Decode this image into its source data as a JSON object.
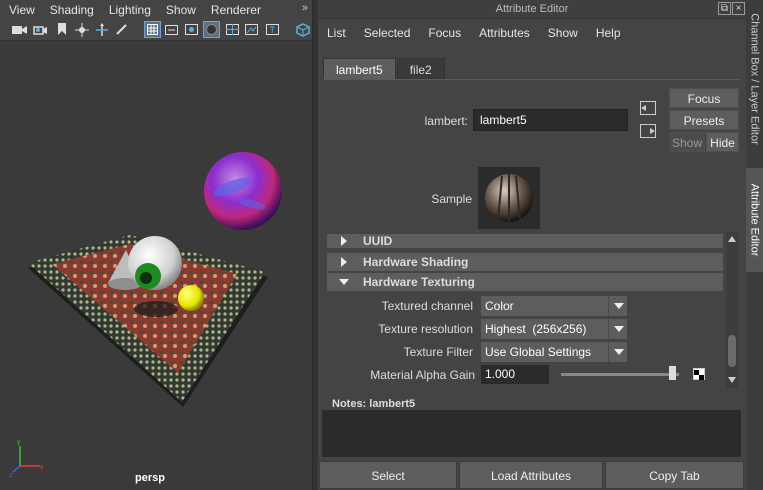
{
  "viewport": {
    "menus": [
      "View",
      "Shading",
      "Lighting",
      "Show",
      "Renderer"
    ],
    "more_glyph": "»",
    "camera_label": "persp",
    "toolbar_icons": [
      "camera-icon",
      "camera-attributes-icon",
      "bookmark-icon",
      "move-pivot-icon",
      "brush-icon",
      "grid-icon",
      "film-gate-icon",
      "resolution-gate-icon",
      "gate-mask-icon",
      "field-chart-icon",
      "safe-action-icon",
      "safe-title-icon",
      "isolate-icon"
    ],
    "axis_colors": {
      "x": "#e04040",
      "y": "#40c040",
      "z": "#4060e0"
    }
  },
  "attribute_editor": {
    "title": "Attribute Editor",
    "menus": [
      "List",
      "Selected",
      "Focus",
      "Attributes",
      "Show",
      "Help"
    ],
    "tabs": [
      "lambert5",
      "file2"
    ],
    "active_tab": "lambert5",
    "node_type_label": "lambert:",
    "node_name": "lambert5",
    "buttons": {
      "focus": "Focus",
      "presets": "Presets",
      "show": "Show",
      "hide": "Hide"
    },
    "sample_label": "Sample",
    "sections": [
      {
        "label": "UUID",
        "expanded": false
      },
      {
        "label": "Hardware Shading",
        "expanded": false
      },
      {
        "label": "Hardware Texturing",
        "expanded": true
      }
    ],
    "attributes": {
      "textured_channel": {
        "label": "Textured channel",
        "value": "Color"
      },
      "texture_resolution": {
        "label": "Texture resolution",
        "value": "Highest  (256x256)"
      },
      "texture_filter": {
        "label": "Texture Filter",
        "value": "Use Global Settings"
      },
      "material_alpha_gain": {
        "label": "Material Alpha Gain",
        "value": "1.000",
        "slider_fraction": 1.0
      }
    },
    "notes_label": "Notes:  lambert5",
    "notes_value": "",
    "bottom_buttons": {
      "select": "Select",
      "load_attributes": "Load Attributes",
      "copy_tab": "Copy Tab"
    }
  },
  "right_tabs": [
    "Channel Box / Layer Editor",
    "Attribute Editor"
  ],
  "active_right_tab": "Attribute Editor",
  "colors": {
    "panel_bg": "#444444",
    "field_bg": "#2b2b2b",
    "button_bg": "#5d5d5d",
    "active_tool_blue": "#5b6f86"
  }
}
